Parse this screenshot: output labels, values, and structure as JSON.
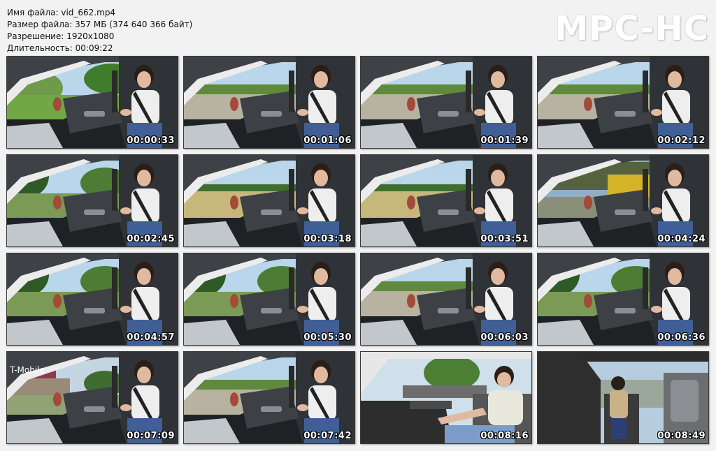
{
  "file_info": [
    "Имя файла: vid_662.mp4",
    "Размер файла: 357 МБ (374 640 366 байт)",
    "Разрешение: 1920x1080",
    "Длительность: 00:09:22"
  ],
  "logo": "MPC-HC",
  "sign_text": "T-Mobile",
  "frames": [
    {
      "time": "00:00:33",
      "scene": "grass"
    },
    {
      "time": "00:01:06",
      "scene": "road"
    },
    {
      "time": "00:01:39",
      "scene": "road"
    },
    {
      "time": "00:02:12",
      "scene": "road"
    },
    {
      "time": "00:02:45",
      "scene": "trees"
    },
    {
      "time": "00:03:18",
      "scene": "field"
    },
    {
      "time": "00:03:51",
      "scene": "field"
    },
    {
      "time": "00:04:24",
      "scene": "tractor"
    },
    {
      "time": "00:04:57",
      "scene": "trees"
    },
    {
      "time": "00:05:30",
      "scene": "trees"
    },
    {
      "time": "00:06:03",
      "scene": "road"
    },
    {
      "time": "00:06:36",
      "scene": "trees"
    },
    {
      "time": "00:07:09",
      "scene": "sign"
    },
    {
      "time": "00:07:42",
      "scene": "road"
    },
    {
      "time": "00:08:16",
      "scene": "closeup"
    },
    {
      "time": "00:08:49",
      "scene": "open"
    }
  ]
}
